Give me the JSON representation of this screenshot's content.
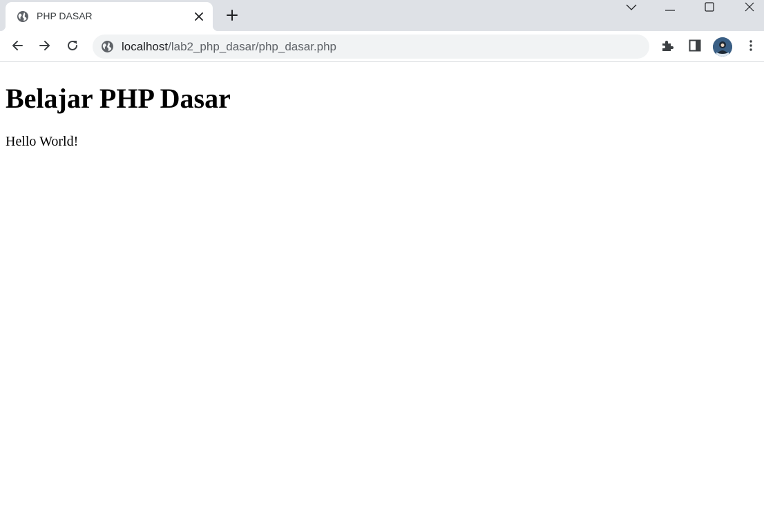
{
  "browser": {
    "tab": {
      "title": "PHP DASAR",
      "favicon": "globe-icon"
    },
    "omnibox": {
      "host": "localhost",
      "path": "/lab2_php_dasar/php_dasar.php",
      "site_icon": "globe-icon"
    },
    "colors": {
      "tabstrip": "#dee1e6",
      "omnibox": "#f1f3f4",
      "icon": "#5f6368"
    }
  },
  "page": {
    "heading": "Belajar PHP Dasar",
    "text": "Hello World!"
  }
}
